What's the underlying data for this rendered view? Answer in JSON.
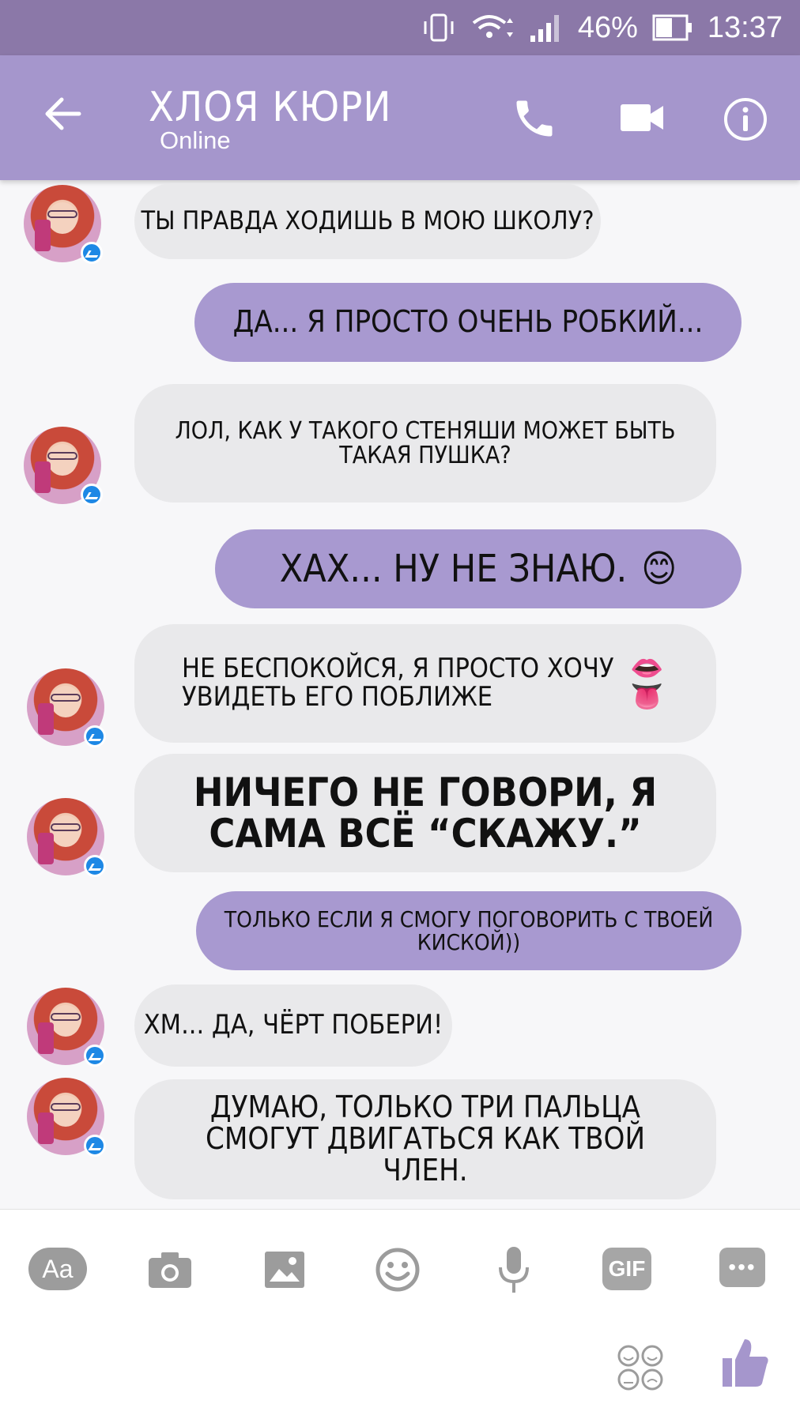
{
  "status_bar": {
    "battery": "46%",
    "time": "13:37"
  },
  "header": {
    "title": "ХЛОЯ КЮРИ",
    "subtitle": "Online"
  },
  "messages": [
    {
      "side": "in",
      "text": "ТЫ ПРАВДА ХОДИШЬ В МОЮ ШКОЛУ?"
    },
    {
      "side": "out",
      "text": "ДА... Я ПРОСТО ОЧЕНЬ РОБКИЙ..."
    },
    {
      "side": "in",
      "text": "ЛОЛ, КАК У ТАКОГО СТЕНЯШИ МОЖЕТ БЫТЬ ТАКАЯ ПУШКА?"
    },
    {
      "side": "out",
      "text": "ХАХ... НУ НЕ ЗНАЮ.",
      "emoji": "😊"
    },
    {
      "side": "in",
      "text": "НЕ БЕСПОКОЙСЯ, Я ПРОСТО ХОЧУ УВИДЕТЬ ЕГО ПОБЛИЖЕ",
      "emoji": "👄👅"
    },
    {
      "side": "in",
      "text": "НИЧЕГО НЕ ГОВОРИ, Я САМА ВСЁ “СКАЖУ.”"
    },
    {
      "side": "out",
      "text": "ТОЛЬКО ЕСЛИ Я СМОГУ ПОГОВОРИТЬ С ТВОЕЙ КИСКОЙ))"
    },
    {
      "side": "in",
      "text": "ХМ... ДА, ЧЁРТ ПОБЕРИ!"
    },
    {
      "side": "in",
      "text": "ДУМАЮ, ТОЛЬКО ТРИ ПАЛЬЦА СМОГУТ ДВИГАТЬСЯ КАК ТВОЙ ЧЛЕН."
    }
  ],
  "composer": {
    "aa_label": "Aa",
    "gif_label": "GIF",
    "more_label": "•••"
  },
  "colors": {
    "status_bar": "#8b78a8",
    "header": "#a596cc",
    "outgoing_bubble": "#a899d0",
    "incoming_bubble": "#e9e9eb",
    "messenger_badge": "#1e88e5"
  }
}
